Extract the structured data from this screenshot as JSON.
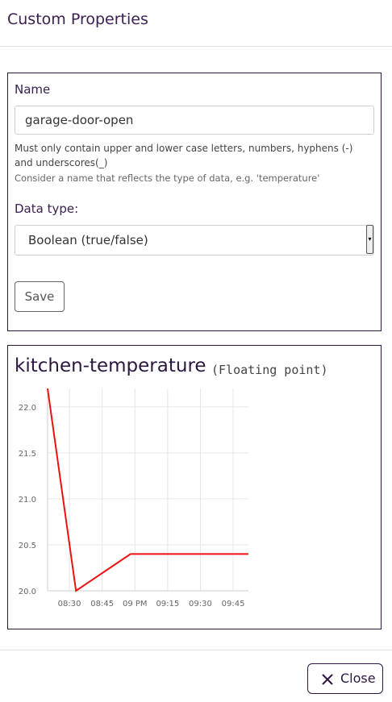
{
  "header": {
    "title": "Custom Properties"
  },
  "form": {
    "name_label": "Name",
    "name_value": "garage-door-open",
    "help_line1": "Must only contain upper and lower case letters, numbers, hyphens (-)",
    "help_line2": "and underscores(_)",
    "hint": "Consider a name that reflects the type of data, e.g. 'temperature'",
    "type_label": "Data type:",
    "type_value": "Boolean (true/false)",
    "save_label": "Save"
  },
  "property": {
    "name": "kitchen-temperature",
    "type": "(Floating point)"
  },
  "chart_data": {
    "type": "line",
    "x": [
      "08:20",
      "08:33",
      "08:58",
      "09:20",
      "09:52"
    ],
    "x_ticks": [
      "08:30",
      "08:45",
      "09 PM",
      "09:15",
      "09:30",
      "09:45"
    ],
    "values": [
      22.2,
      20.0,
      20.4,
      20.4,
      20.4
    ],
    "y_ticks": [
      "20.0",
      "20.5",
      "21.0",
      "21.5",
      "22.0"
    ],
    "ylim": [
      20.0,
      22.2
    ],
    "xrange": [
      "08:20",
      "09:52"
    ],
    "grid": true,
    "line_color": "#ee1111"
  },
  "footer": {
    "close_label": "Close"
  },
  "colors": {
    "accent": "#2b1740",
    "title": "#3a2150"
  }
}
